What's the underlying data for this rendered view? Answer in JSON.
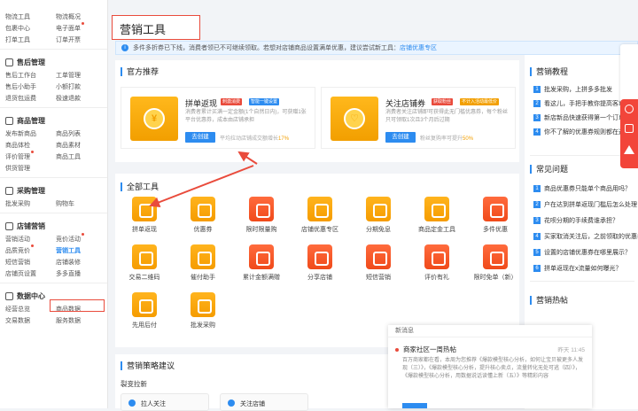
{
  "sidebar": {
    "top_rows": [
      [
        "物流工具",
        "物流概况"
      ],
      [
        "包裹中心",
        "电子面单"
      ],
      [
        "打单工具",
        "订单开票"
      ]
    ],
    "sections": [
      {
        "title": "售后管理",
        "rows": [
          [
            "售后工作台",
            "工单管理"
          ],
          [
            "售后小助手",
            "小额打款"
          ],
          [
            "退货包运费",
            "极速退款"
          ]
        ]
      },
      {
        "title": "商品管理",
        "rows": [
          [
            "发布新商品",
            "商品列表"
          ],
          [
            "商品体检",
            "商品素材"
          ],
          [
            "评价管理",
            "商品工具"
          ],
          [
            "供货管理",
            ""
          ]
        ]
      },
      {
        "title": "采购管理",
        "rows": [
          [
            "批发采购",
            "购物车"
          ]
        ]
      },
      {
        "title": "店铺营销",
        "rows": [
          [
            "营销活动",
            "竞价活动"
          ],
          [
            "品质竞价",
            "营销工具"
          ],
          [
            "短信营销",
            "店铺装修"
          ],
          [
            "店铺页设置",
            "多多直播"
          ]
        ]
      },
      {
        "title": "数据中心",
        "rows": [
          [
            "经营总览",
            "商品数据"
          ],
          [
            "交易数据",
            "服务数据"
          ]
        ]
      }
    ]
  },
  "page": {
    "title": "营销工具",
    "notice": "多件多折券已下线，消费者领已不可继续领取。若想对店铺商品设置满单优惠，建议尝试新工具：",
    "notice_link": "店铺优惠专区"
  },
  "official": {
    "title": "官方推荐",
    "promos": [
      {
        "name": "拼单返现",
        "tags": [
          "刺激消费",
          "智能一键设置"
        ],
        "desc": "消费者累计买满一定金额(1个自然日内)，可获赠1张平台优惠券，成本由店铺承担",
        "button": "去创建",
        "stat_text": "平均拉动店铺成交额增长",
        "stat_value": "17%",
        "glyph": "¥"
      },
      {
        "name": "关注店铺券",
        "tags": [
          "获取粉丝",
          "不计入活动最低价"
        ],
        "desc": "消费者关注店铺即可获得此无门槛优惠券，每个粉丝只可领取1次且3个月后过期",
        "button": "去创建",
        "stat_text": "粉丝复购率可提升",
        "stat_value": "50%",
        "glyph": "♡"
      }
    ]
  },
  "all_tools": {
    "title": "全部工具",
    "items": [
      {
        "label": "拼单返现",
        "color": "orange"
      },
      {
        "label": "优惠券",
        "color": "orange"
      },
      {
        "label": "限时限量购",
        "color": "red"
      },
      {
        "label": "店铺优惠专区",
        "color": "orange"
      },
      {
        "label": "分期免息",
        "color": "orange"
      },
      {
        "label": "商品定金工具",
        "color": "orange"
      },
      {
        "label": "多件优惠",
        "color": "red"
      },
      {
        "label": "交易二维码",
        "color": "orange"
      },
      {
        "label": "催付助手",
        "color": "orange"
      },
      {
        "label": "累计金额满赠",
        "color": "red"
      },
      {
        "label": "分享店铺",
        "color": "red"
      },
      {
        "label": "短信营销",
        "color": "red"
      },
      {
        "label": "评价有礼",
        "color": "red"
      },
      {
        "label": "限时免单（新）",
        "color": "red"
      },
      {
        "label": "先用后付",
        "color": "orange"
      },
      {
        "label": "批发采购",
        "color": "orange"
      }
    ]
  },
  "strategy": {
    "title": "营销策略建议",
    "subtitle": "裂变拉新",
    "cards": [
      "拉人关注",
      "关注店铺"
    ]
  },
  "right": {
    "tutorials_title": "营销教程",
    "tutorials": [
      "批发采购，上拼多多批发",
      "看这儿，手把手教你提高客单价",
      "新店新品快速获得第一个订单",
      "你不了解的优惠券规则都在这里"
    ],
    "faq_title": "常见问题",
    "faq": [
      "商品优惠券只能单个商品用吗？",
      "户在达到拼单返现门槛后怎么处理",
      "花呗分期的手续费谁承担？",
      "买家取消关注后，之前领取的优惠券",
      "设置的店铺优惠券在哪里展示？",
      "拼单返现在x流量如何曝光？"
    ],
    "hot_title": "营销热帖"
  },
  "popup": {
    "header": "新消息",
    "title": "商家社区一周热帖",
    "time": "昨天 11:45",
    "body": "百万商家都在看，本周为您推荐《爆款模型核心分析，如何让宝贝被更多人发现（三）》，《爆款模型核心分析，提升核心卖点，流量转化无处可逃（四）》，《爆款模型核心分析，用数据说话读懂上新（五）》等精彩内容"
  }
}
